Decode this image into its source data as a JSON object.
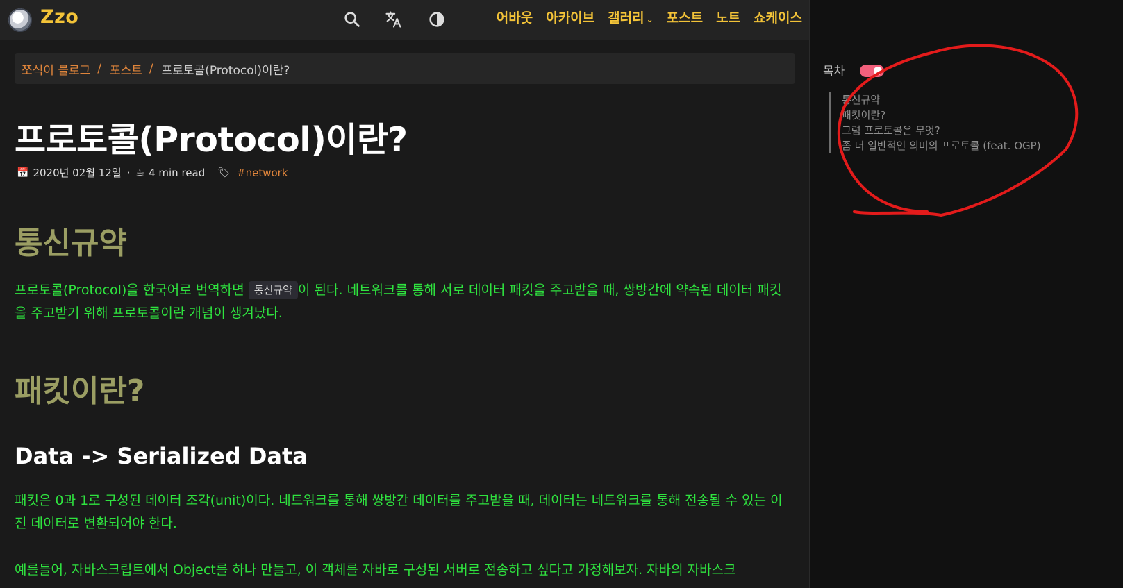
{
  "navbar": {
    "logo_text": "Zzo",
    "icons": [
      "search-icon",
      "translate-icon",
      "theme-contrast-icon"
    ],
    "links": [
      {
        "label": "어바웃"
      },
      {
        "label": "아카이브"
      },
      {
        "label": "갤러리",
        "has_dropdown": true
      },
      {
        "label": "포스트"
      },
      {
        "label": "노트"
      },
      {
        "label": "쇼케이스"
      }
    ]
  },
  "breadcrumb": {
    "items": [
      "쪼식이 블로그",
      "포스트"
    ],
    "separator": "/",
    "current": "프로토콜(Protocol)이란?"
  },
  "post": {
    "title": "프로토콜(Protocol)이란?",
    "date": "2020년 02월 12일",
    "date_sep": "·",
    "read_time": "4 min read",
    "tag": "#network",
    "sections": {
      "h2_1": "통신규약",
      "p1_before": "프로토콜(Protocol)을 한국어로 번역하면 ",
      "p1_code": "통신규약",
      "p1_after": "이 된다. 네트워크를 통해 서로 데이터 패킷을 주고받을 때, 쌍방간에 약속된 데이터 패킷을 주고받기 위해 프로토콜이란 개념이 생겨났다.",
      "h2_2": "패킷이란?",
      "h3_1": "Data -> Serialized Data",
      "p2": "패킷은 0과 1로 구성된 데이터 조각(unit)이다. 네트워크를 통해 쌍방간 데이터를 주고받을 때, 데이터는 네트워크를 통해 전송될 수 있는 이진 데이터로 변환되어야 한다.",
      "p3": "예를들어, 자바스크립트에서 Object를 하나 만들고, 이 객체를 자바로 구성된 서버로 전송하고 싶다고 가정해보자. 자바의 자바스크"
    }
  },
  "toc": {
    "title": "목차",
    "toggle_on": true,
    "items": [
      "통신규약",
      "패킷이란?",
      "그럼 프로토콜은 무엇?",
      "좀 더 일반적인 의미의 프로토콜 (feat. OGP)"
    ]
  },
  "colors": {
    "brand": "#f3c338",
    "link": "#e0853b",
    "heading2": "#9b9e63",
    "body_text": "#2fe33f",
    "toggle": "#f2607c",
    "annotation": "#e31b1b"
  }
}
